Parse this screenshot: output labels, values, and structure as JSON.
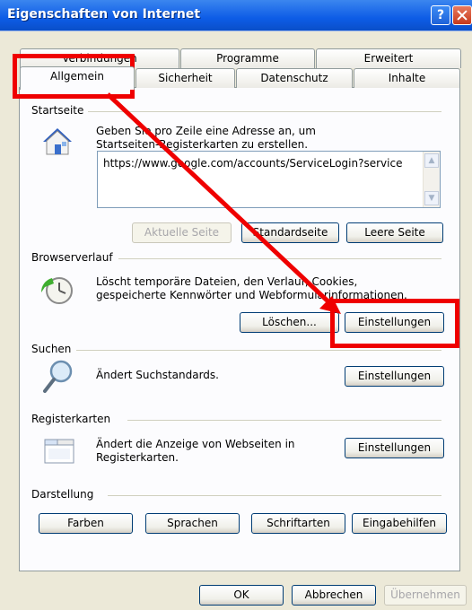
{
  "window": {
    "title": "Eigenschaften von Internet",
    "help": "?"
  },
  "tabs_row1": [
    "Verbindungen",
    "Programme",
    "Erweitert"
  ],
  "tabs_row2": [
    "Allgemein",
    "Sicherheit",
    "Datenschutz",
    "Inhalte"
  ],
  "startseite": {
    "label": "Startseite",
    "desc1": "Geben Sie pro Zeile eine Adresse an, um",
    "desc2": "Startseiten-Registerkarten zu erstellen.",
    "url": "https://www.google.com/accounts/ServiceLogin?service",
    "btn_current": "Aktuelle Seite",
    "btn_default": "Standardseite",
    "btn_blank": "Leere Seite"
  },
  "verlauf": {
    "label": "Browserverlauf",
    "desc1": "Löscht temporäre Dateien, den Verlauf, Cookies,",
    "desc2": "gespeicherte Kennwörter und Webformularinformationen.",
    "btn_delete": "Löschen...",
    "btn_settings": "Einstellungen"
  },
  "suchen": {
    "label": "Suchen",
    "desc": "Ändert Suchstandards.",
    "btn_settings": "Einstellungen"
  },
  "register": {
    "label": "Registerkarten",
    "desc1": "Ändert die Anzeige von Webseiten in",
    "desc2": "Registerkarten.",
    "btn_settings": "Einstellungen"
  },
  "darstellung": {
    "label": "Darstellung",
    "btn_colors": "Farben",
    "btn_lang": "Sprachen",
    "btn_fonts": "Schriftarten",
    "btn_access": "Eingabehilfen"
  },
  "footer": {
    "ok": "OK",
    "cancel": "Abbrechen",
    "apply": "Übernehmen"
  },
  "colors": {
    "highlight": "#ef0000",
    "titlebar": "#0d5ce6"
  },
  "icons": [
    "help-icon",
    "close-icon",
    "home-icon",
    "history-icon",
    "search-icon",
    "tabs-icon"
  ]
}
